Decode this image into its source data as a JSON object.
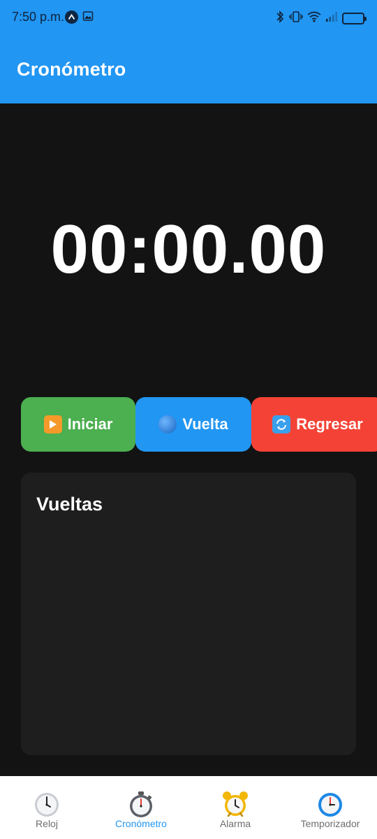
{
  "status_bar": {
    "time": "7:50 p.m."
  },
  "header": {
    "title": "Cronómetro"
  },
  "timer": {
    "display": "00:00.00"
  },
  "controls": {
    "start_label": "Iniciar",
    "lap_label": "Vuelta",
    "reset_label": "Regresar"
  },
  "laps": {
    "title": "Vueltas",
    "items": []
  },
  "nav": {
    "items": [
      {
        "label": "Reloj",
        "icon": "clock-icon"
      },
      {
        "label": "Cronómetro",
        "icon": "stopwatch-icon",
        "active": true
      },
      {
        "label": "Alarma",
        "icon": "alarm-clock-icon"
      },
      {
        "label": "Temporizador",
        "icon": "timer-icon"
      }
    ]
  },
  "colors": {
    "primary": "#2196F3",
    "start": "#4CAF50",
    "reset": "#F44336",
    "background": "#131313",
    "panel": "#1e1e1e"
  }
}
